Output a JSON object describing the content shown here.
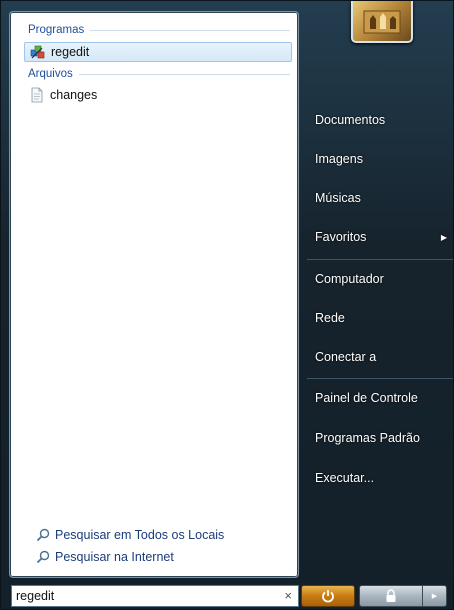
{
  "left": {
    "programs_header": "Programas",
    "programs": [
      {
        "label": "regedit",
        "icon": "regedit-icon",
        "selected": true
      }
    ],
    "files_header": "Arquivos",
    "files": [
      {
        "label": "changes",
        "icon": "document-icon"
      }
    ],
    "search_links": [
      {
        "label": "Pesquisar em Todos os Locais",
        "icon": "search-icon"
      },
      {
        "label": "Pesquisar na Internet",
        "icon": "search-icon"
      }
    ]
  },
  "right": {
    "items": [
      {
        "label": "Documentos"
      },
      {
        "label": "Imagens"
      },
      {
        "label": "Músicas"
      },
      {
        "label": "Favoritos",
        "has_submenu": true
      },
      {
        "label": "Computador"
      },
      {
        "label": "Rede"
      },
      {
        "label": "Conectar a"
      },
      {
        "label": "Painel de Controle"
      },
      {
        "label": "Programas Padrão"
      },
      {
        "label": "Executar..."
      }
    ]
  },
  "search": {
    "value": "regedit",
    "clear_glyph": "×"
  },
  "buttons": {
    "power": "power-icon",
    "lock": "lock-icon",
    "options": "arrow-right-icon"
  },
  "colors": {
    "accent": "#1e4f9c",
    "power": "#c97b13",
    "selection": "#d4e8f8"
  }
}
